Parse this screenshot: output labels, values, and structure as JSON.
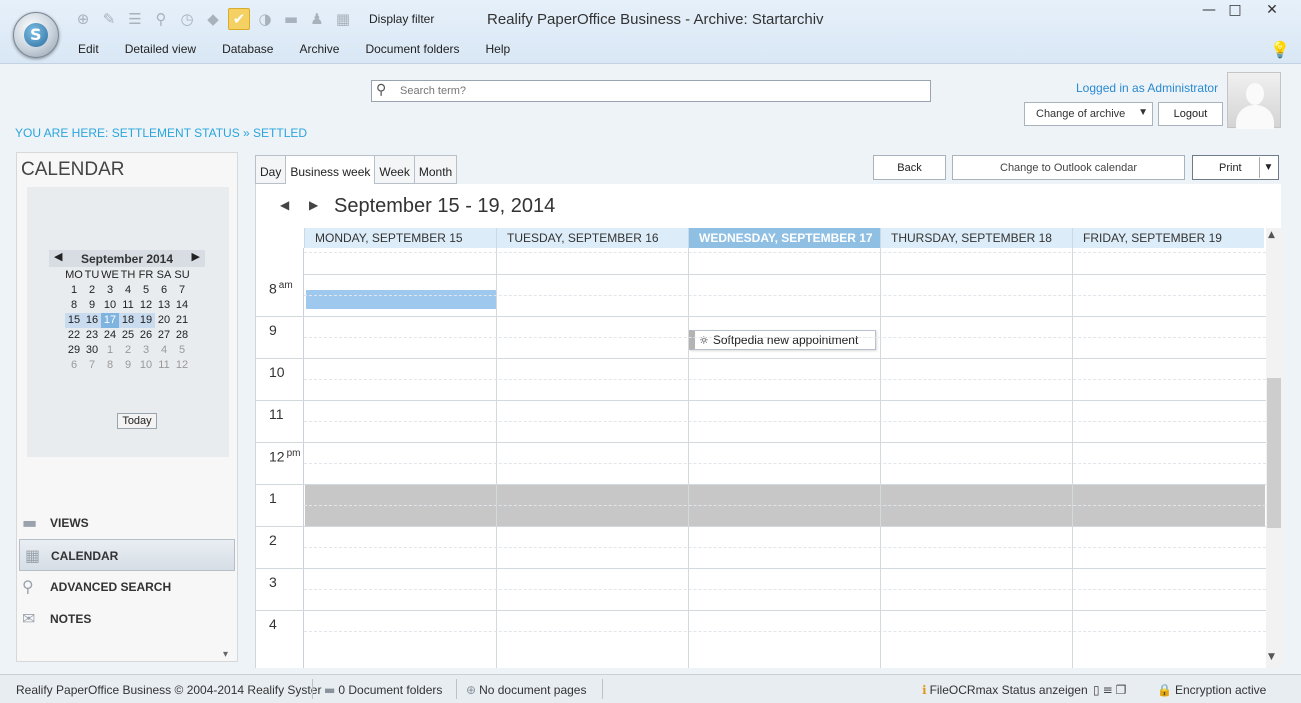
{
  "window": {
    "title": "Realify PaperOffice Business - Archive: Startarchiv",
    "minimize": "—",
    "maximize": "□",
    "close": "✕"
  },
  "toolbar": {
    "display_filter_label": "Display filter",
    "icons": [
      "add-icon",
      "brush-icon",
      "list-icon",
      "pin-icon",
      "clock-icon",
      "tag-icon",
      "check-filter-icon",
      "contrast-icon",
      "folder-icon",
      "person-icon",
      "calendar-icon"
    ]
  },
  "menu": [
    "Edit",
    "Detailed view",
    "Database",
    "Archive",
    "Document folders",
    "Help"
  ],
  "search": {
    "placeholder": "Search term?",
    "value": ""
  },
  "user": {
    "logged_in": "Logged in as Administrator",
    "change_archive": "Change of archive",
    "logout": "Logout"
  },
  "breadcrumb": "YOU ARE HERE: SETTLEMENT STATUS » SETTLED",
  "left_panel": {
    "title": "CALENDAR",
    "mini_calendar": {
      "month": "September 2014",
      "weekdays": [
        "MO",
        "TU",
        "WE",
        "TH",
        "FR",
        "SA",
        "SU"
      ],
      "weeks": [
        [
          "1",
          "2",
          "3",
          "4",
          "5",
          "6",
          "7"
        ],
        [
          "8",
          "9",
          "10",
          "11",
          "12",
          "13",
          "14"
        ],
        [
          "15",
          "16",
          "17",
          "18",
          "19",
          "20",
          "21"
        ],
        [
          "22",
          "23",
          "24",
          "25",
          "26",
          "27",
          "28"
        ],
        [
          "29",
          "30",
          "1",
          "2",
          "3",
          "4",
          "5"
        ],
        [
          "6",
          "7",
          "8",
          "9",
          "10",
          "11",
          "12"
        ]
      ],
      "today_button": "Today"
    },
    "nav": [
      {
        "label": "VIEWS",
        "icon": "folder-icon"
      },
      {
        "label": "CALENDAR",
        "icon": "calendar-icon",
        "active": true
      },
      {
        "label": "ADVANCED SEARCH",
        "icon": "search-icon"
      },
      {
        "label": "NOTES",
        "icon": "note-icon"
      }
    ]
  },
  "calendar": {
    "view_tabs": [
      "Day",
      "Business week",
      "Week",
      "Month"
    ],
    "active_tab": "Business week",
    "back": "Back",
    "outlook": "Change to Outlook calendar",
    "print": "Print",
    "range_title": "September 15 - 19, 2014",
    "days": [
      "MONDAY, SEPTEMBER 15",
      "TUESDAY, SEPTEMBER 16",
      "WEDNESDAY, SEPTEMBER 17",
      "THURSDAY, SEPTEMBER 18",
      "FRIDAY, SEPTEMBER 19"
    ],
    "today_index": 2,
    "hours": [
      {
        "h": "8",
        "suffix": "am"
      },
      {
        "h": "9",
        "suffix": ""
      },
      {
        "h": "10",
        "suffix": ""
      },
      {
        "h": "11",
        "suffix": ""
      },
      {
        "h": "12",
        "suffix": "pm"
      },
      {
        "h": "1",
        "suffix": ""
      },
      {
        "h": "2",
        "suffix": ""
      },
      {
        "h": "3",
        "suffix": ""
      },
      {
        "h": "4",
        "suffix": ""
      }
    ],
    "appointment": "Softpedia new appointment"
  },
  "status": {
    "copyright": "Realify PaperOffice Business © 2004-2014 Realify Syster",
    "folders": "0 Document folders",
    "pages": "No document pages",
    "ocr": "FileOCRmax Status anzeigen",
    "encryption": "Encryption active"
  },
  "colors": {
    "accent": "#2aa5de",
    "today_header": "#8fbfe3",
    "selection": "#9ec8ee"
  }
}
